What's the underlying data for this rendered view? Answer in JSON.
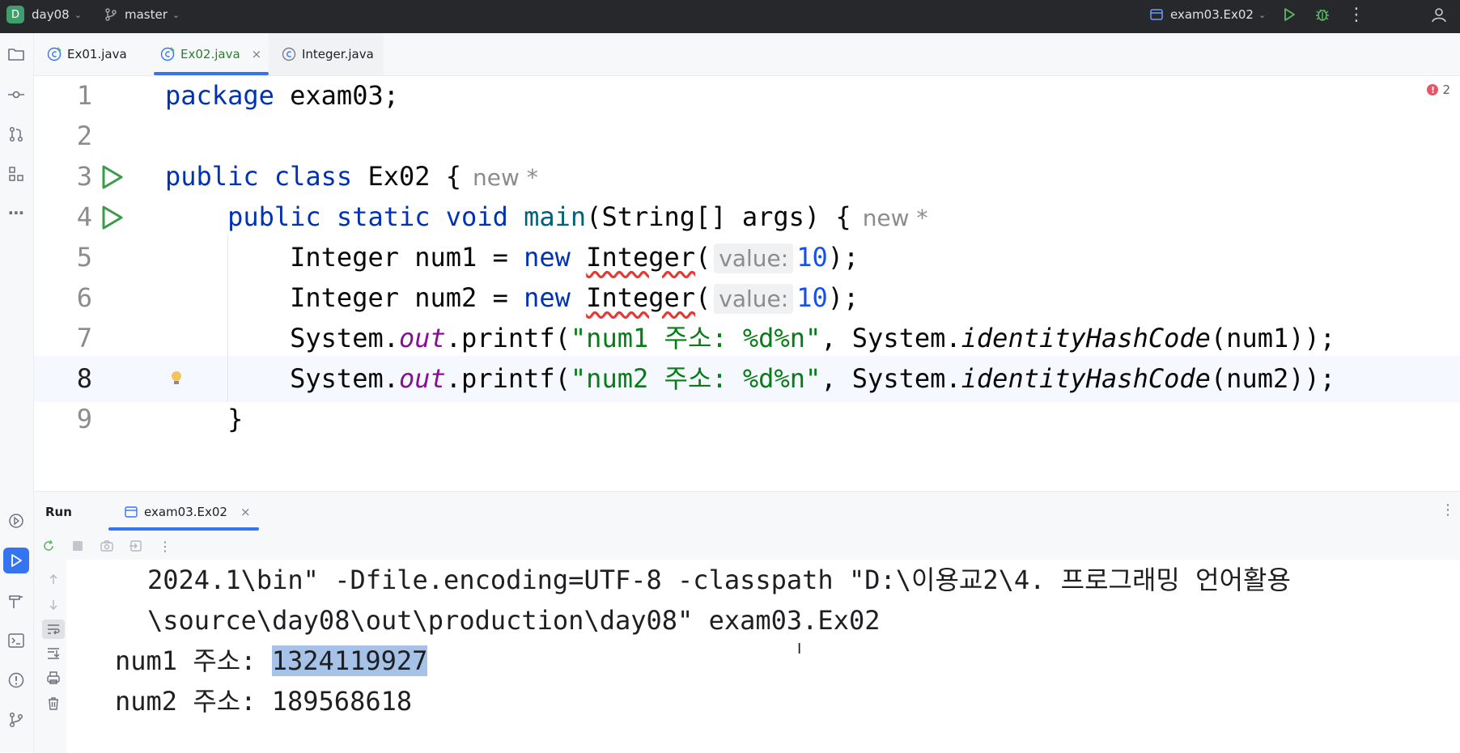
{
  "titlebar": {
    "project_badge": "D",
    "project_name": "day08",
    "branch": "master",
    "run_config": "exam03.Ex02"
  },
  "tabs": [
    {
      "label": "Ex01.java",
      "active": false
    },
    {
      "label": "Ex02.java",
      "active": true,
      "close": "×"
    },
    {
      "label": "Integer.java",
      "active": false
    }
  ],
  "editor": {
    "error_count": "2",
    "error_mark": "!",
    "lines": [
      {
        "n": "1",
        "parts": [
          {
            "t": "package",
            "c": "kw"
          },
          {
            "t": " exam03;",
            "c": ""
          }
        ]
      },
      {
        "n": "2",
        "parts": []
      },
      {
        "n": "3",
        "run": true,
        "parts": [
          {
            "t": "public class",
            "c": "kw"
          },
          {
            "t": " Ex02 {",
            "c": ""
          },
          {
            "t": "new *",
            "c": "vcs"
          }
        ]
      },
      {
        "n": "4",
        "run": true,
        "parts": [
          {
            "t": "    public static void",
            "c": "kw"
          },
          {
            "t": " main",
            "c": "fn"
          },
          {
            "t": "(String[] args) {",
            "c": ""
          },
          {
            "t": "new *",
            "c": "vcs"
          }
        ]
      },
      {
        "n": "5",
        "guide": true,
        "parts": [
          {
            "t": "        Integer num1 = ",
            "c": ""
          },
          {
            "t": "new",
            "c": "kw"
          },
          {
            "t": " ",
            "c": ""
          },
          {
            "t": "Integer",
            "c": "squig"
          },
          {
            "t": "(",
            "c": ""
          },
          {
            "t": "value:",
            "c": "hint"
          },
          {
            "t": "10",
            "c": "num"
          },
          {
            "t": ");",
            "c": ""
          }
        ]
      },
      {
        "n": "6",
        "guide": true,
        "parts": [
          {
            "t": "        Integer num2 = ",
            "c": ""
          },
          {
            "t": "new",
            "c": "kw"
          },
          {
            "t": " ",
            "c": ""
          },
          {
            "t": "Integer",
            "c": "squig"
          },
          {
            "t": "(",
            "c": ""
          },
          {
            "t": "value:",
            "c": "hint"
          },
          {
            "t": "10",
            "c": "num"
          },
          {
            "t": ");",
            "c": ""
          }
        ]
      },
      {
        "n": "7",
        "guide": true,
        "parts": [
          {
            "t": "        System.",
            "c": ""
          },
          {
            "t": "out",
            "c": "stat"
          },
          {
            "t": ".printf(",
            "c": ""
          },
          {
            "t": "\"num1 주소: %d%n\"",
            "c": "str"
          },
          {
            "t": ", System.",
            "c": ""
          },
          {
            "t": "identityHashCode",
            "c": "ital"
          },
          {
            "t": "(num1));",
            "c": ""
          }
        ]
      },
      {
        "n": "8",
        "current": true,
        "bulb": true,
        "guide": true,
        "parts": [
          {
            "t": "        System.",
            "c": ""
          },
          {
            "t": "out",
            "c": "stat"
          },
          {
            "t": ".printf(",
            "c": ""
          },
          {
            "t": "\"num2 주소: %d%n\"",
            "c": "str"
          },
          {
            "t": ", System.",
            "c": ""
          },
          {
            "t": "identityHashCode",
            "c": "ital"
          },
          {
            "t": "(num2));",
            "c": ""
          }
        ]
      },
      {
        "n": "9",
        "parts": [
          {
            "t": "    }",
            "c": ""
          }
        ]
      }
    ]
  },
  "run": {
    "title": "Run",
    "tab_label": "exam03.Ex02",
    "tab_close": "×",
    "console": {
      "cmd_line_1": "2024.1\\bin\" -Dfile.encoding=UTF-8 -classpath \"D:\\이용교2\\4. 프로그래밍 언어활용",
      "cmd_line_2": "\\source\\day08\\out\\production\\day08\" exam03.Ex02",
      "out1_prefix": "num1 주소: ",
      "out1_value": "1324119927",
      "out2": "num2 주소: 189568618",
      "cursor": "I"
    }
  },
  "colors": {
    "accent": "#3574f0",
    "run_green": "#3a9c4a",
    "string_green": "#067d17",
    "keyword_blue": "#0033b3"
  }
}
